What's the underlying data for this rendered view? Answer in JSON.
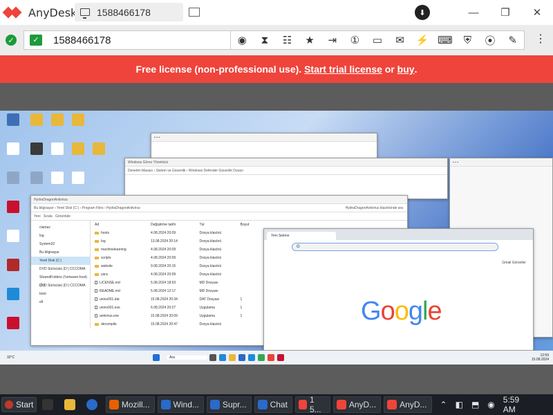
{
  "app": {
    "name": "AnyDesk"
  },
  "session_tab": {
    "label": "1588466178"
  },
  "address": {
    "value": "1588466178"
  },
  "toolbar_icons": [
    "privacy-icon",
    "hourglass-icon",
    "database-icon",
    "star-icon",
    "file-transfer-icon",
    "monitor-1-icon",
    "screen-icon",
    "chat-icon",
    "action-icon",
    "keyboard-icon",
    "shield-icon",
    "record-icon",
    "draw-icon"
  ],
  "banner": {
    "prefix": "Free license (non-professional use).",
    "trial_link": "Start trial license",
    "middle": "or",
    "buy_link": "buy",
    "suffix": ".",
    "color": "#ef443b"
  },
  "remote": {
    "windows": {
      "winmanager": {
        "title": "Windows Görev Yöneticisi"
      },
      "defender": {
        "title": "Windows Defender Güvenlik Duvarı"
      },
      "defender_breadcrumb": "Denetim Masası › Sistem ve Güvenlik › Windows Defender Güvenlik Duvarı",
      "explorer": {
        "title": "HydraDragonAntivirus",
        "breadcrumb": "Bu bilgisayar › Yerel Disk (C:) › Program Files › HydraDragonAntivirus",
        "search_placeholder": "HydraDragonAntivirus klasöründe ara",
        "toolbar": {
          "new": "Yeni",
          "sort": "Sırala",
          "view": "Görüntüle"
        },
        "columns": {
          "name": "Ad",
          "date": "Değiştirme tarihi",
          "type": "Tür",
          "size": "Boyut"
        },
        "sidebar": [
          "clamav",
          "log",
          "System32",
          "Bu bilgisayar",
          "Yerel Disk (C:)",
          "DVD Sürücüsü (D:) CCCOMA",
          "SharedFolders (\\\\vmware-host) (Z:)",
          "DVD Sürücüsü (D:) CCCOMA",
          "boot",
          "efi"
        ],
        "rows": [
          {
            "name": "hosts",
            "date": "4.08.2024 20:09",
            "type": "Dosya klasörü",
            "size": "",
            "kind": "folder"
          },
          {
            "name": "log",
            "date": "13.08.2024 20:14",
            "type": "Dosya klasörü",
            "size": "",
            "kind": "folder"
          },
          {
            "name": "machinelearning",
            "date": "4.08.2024 20:09",
            "type": "Dosya klasörü",
            "size": "",
            "kind": "folder"
          },
          {
            "name": "scripts",
            "date": "4.08.2024 20:09",
            "type": "Dosya klasörü",
            "size": "",
            "kind": "folder"
          },
          {
            "name": "website",
            "date": "9.08.2024 20:15",
            "type": "Dosya klasörü",
            "size": "",
            "kind": "folder"
          },
          {
            "name": "yara",
            "date": "4.08.2024 20:09",
            "type": "Dosya klasörü",
            "size": "",
            "kind": "folder"
          },
          {
            "name": "LICENSE.md",
            "date": "5.08.2024 18:53",
            "type": "MD Dosyası",
            "size": "",
            "kind": "file"
          },
          {
            "name": "README.md",
            "date": "5.08.2024 12:17",
            "type": "MD Dosyası",
            "size": "",
            "kind": "file"
          },
          {
            "name": "unins001.dat",
            "date": "15.08.2024 20:34",
            "type": "DAT Dosyası",
            "size": "1",
            "kind": "file"
          },
          {
            "name": "unins001.exe",
            "date": "6.08.2024 20:27",
            "type": "Uygulama",
            "size": "1",
            "kind": "file"
          },
          {
            "name": "antivirus.exe",
            "date": "15.08.2024 20:09",
            "type": "Uygulama",
            "size": "1",
            "kind": "file"
          },
          {
            "name": "decompile",
            "date": "15.08.2024 20:47",
            "type": "Dosya klasörü",
            "size": "",
            "kind": "folder"
          }
        ]
      },
      "chrome": {
        "tab_title": "Yeni Sekme",
        "omnibox": "G",
        "links": "Gmail  Görseller",
        "logo": [
          "G",
          "o",
          "o",
          "g",
          "l",
          "e"
        ]
      }
    },
    "desktop_icons": [
      "Bu bilgisayar",
      "Ağ",
      "Geri Dönüşüm",
      "Microsoft Edge",
      "Firefox"
    ],
    "taskbar": {
      "search": "Ara",
      "clock": "12:59",
      "date": "15.08.2024",
      "weather": "32°C"
    }
  },
  "taskbar": {
    "start": "Start",
    "buttons": [
      {
        "label": "Mozill...",
        "color": "#e66000"
      },
      {
        "label": "Wind...",
        "color": "#2a6ac8"
      },
      {
        "label": "Supr...",
        "color": "#2a6ac8"
      },
      {
        "label": "Chat",
        "color": "#2a6ac8"
      },
      {
        "label": "1 5...",
        "color": "#ef443b"
      },
      {
        "label": "AnyD...",
        "color": "#ef443b"
      },
      {
        "label": "AnyD...",
        "color": "#ef443b"
      }
    ],
    "clock": "5:59 AM"
  }
}
